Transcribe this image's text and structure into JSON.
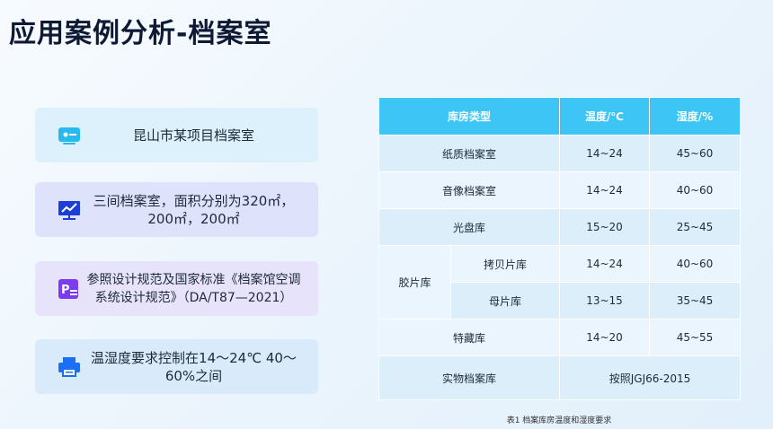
{
  "title": "应用案例分析-档案室",
  "cards": [
    {
      "icon": "monitor-box-icon",
      "text": "昆山市某项目档案室"
    },
    {
      "icon": "presentation-chart-icon",
      "text": "三间档案室，面积分别为320㎡，200㎡，200㎡"
    },
    {
      "icon": "document-p-icon",
      "text": "参照设计规范及国家标准《档案馆空调系统设计规范》（DA/T87—2021）"
    },
    {
      "icon": "printer-icon",
      "text": "温湿度要求控制在14～24℃ 40～60%之间"
    }
  ],
  "table": {
    "headers": [
      "库房类型",
      "温度/℃",
      "湿度/%"
    ],
    "rows": [
      {
        "type": "纸质档案室",
        "temp": "14~24",
        "humidity": "45~60"
      },
      {
        "type": "音像档案室",
        "temp": "14~24",
        "humidity": "40~60"
      },
      {
        "type": "光盘库",
        "temp": "15~20",
        "humidity": "25~45"
      },
      {
        "group": "胶片库",
        "type": "拷贝片库",
        "temp": "14~24",
        "humidity": "40~60"
      },
      {
        "type": "母片库",
        "temp": "13~15",
        "humidity": "35~45"
      },
      {
        "type": "特藏库",
        "temp": "14~20",
        "humidity": "45~55"
      },
      {
        "type": "实物档案库",
        "merged_value": "按照JGJ66-2015"
      }
    ],
    "caption": "表1 档案库房温度和湿度要求"
  },
  "colors": {
    "header": "#3cc5f5",
    "row_odd": "#dbeefa",
    "row_even": "#eaf5fd",
    "icon_blue": "#1b6ff2",
    "icon_purple": "#7b3cf0",
    "icon_cyan": "#28b9ee"
  }
}
